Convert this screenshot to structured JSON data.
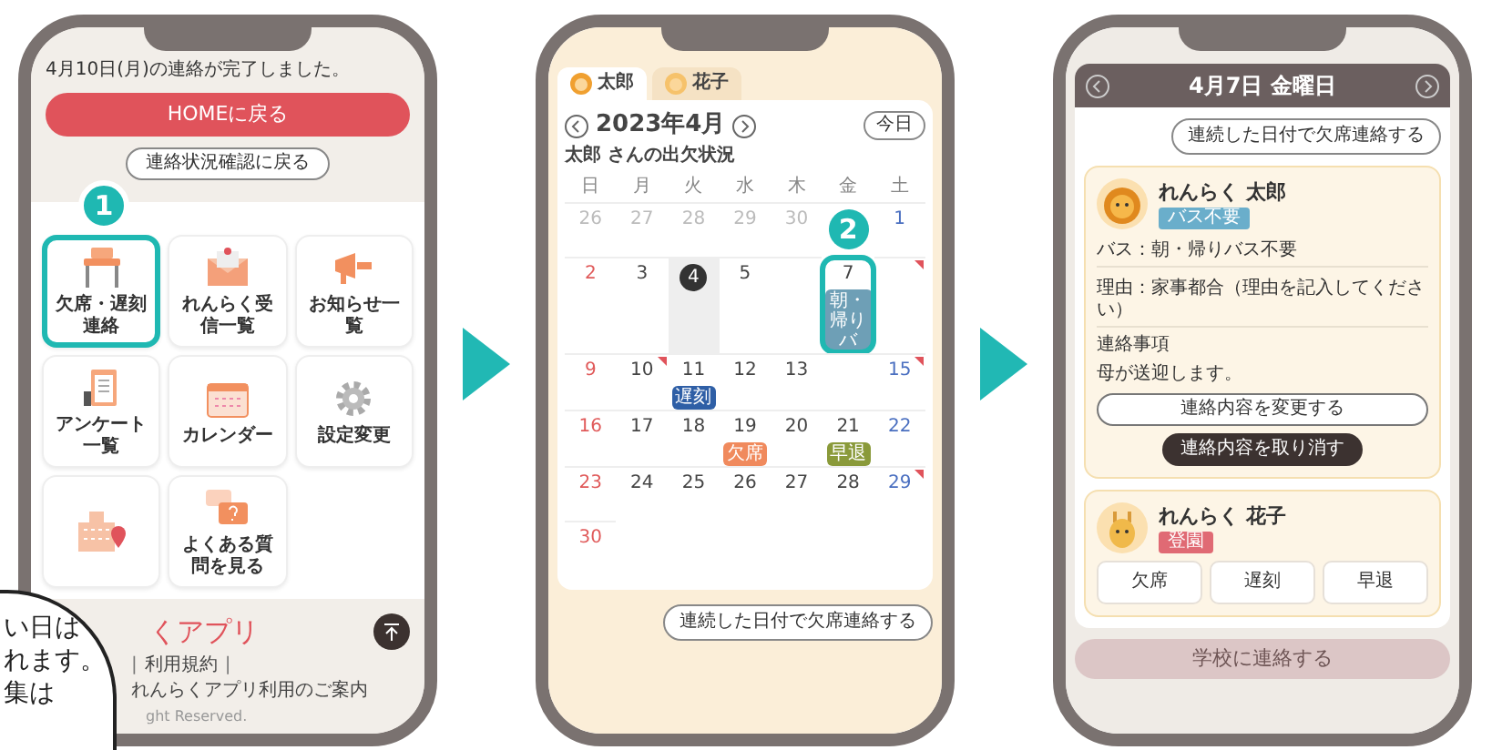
{
  "menu_screen": {
    "message": "4月10日(月)の連絡が完了しました。",
    "home_button": "HOMEに戻る",
    "status_button": "連絡状況確認に戻る",
    "step_badge": "1",
    "tiles": [
      {
        "label": "欠席・遅刻連絡",
        "highlighted": true
      },
      {
        "label": "れんらく受信一覧",
        "highlighted": false
      },
      {
        "label": "お知らせ一覧",
        "highlighted": false
      },
      {
        "label": "アンケート一覧",
        "highlighted": false
      },
      {
        "label": "カレンダー",
        "highlighted": false
      },
      {
        "label": "設定変更",
        "highlighted": false
      },
      {
        "highlighted": false
      },
      {
        "label": "よくある質問を見る",
        "highlighted": false
      }
    ],
    "app_name": "くアプリ",
    "separator": "|",
    "footer_links": [
      "利用規約",
      "れんらくアプリ利用のご案内"
    ],
    "copyright": "ght Reserved."
  },
  "callout_bubble": {
    "lines": [
      "い日は",
      "れます。",
      "集は"
    ]
  },
  "calendar_screen": {
    "tabs": [
      {
        "label": "太郎",
        "selected": true
      },
      {
        "label": "花子",
        "selected": false
      }
    ],
    "month": "2023年4月",
    "today_button": "今日",
    "subtitle": "太郎 さんの出欠状況",
    "weekdays": [
      "日",
      "月",
      "火",
      "水",
      "木",
      "金",
      "土"
    ],
    "weeks": [
      [
        {
          "day": "26",
          "outside": true,
          "today": false,
          "marked": false,
          "circled": false
        },
        {
          "day": "27",
          "outside": true,
          "today": false,
          "marked": false,
          "circled": false
        },
        {
          "day": "28",
          "outside": true,
          "today": false,
          "marked": false,
          "circled": false
        },
        {
          "day": "29",
          "outside": true,
          "today": false,
          "marked": false,
          "circled": false
        },
        {
          "day": "30",
          "outside": true,
          "today": false,
          "marked": false,
          "circled": false
        },
        {
          "step_badge": "2",
          "marked": false,
          "circled": false
        },
        {
          "day": "1",
          "outside": false,
          "today": false,
          "marked": false,
          "circled": false
        }
      ],
      [
        {
          "day": "2",
          "outside": false,
          "today": false,
          "marked": false,
          "circled": false
        },
        {
          "day": "3",
          "outside": false,
          "today": false,
          "marked": false,
          "circled": false
        },
        {
          "day": "4",
          "outside": false,
          "today": true,
          "marked": false,
          "circled": false
        },
        {
          "day": "5",
          "outside": false,
          "today": false,
          "marked": false,
          "circled": false
        },
        {
          "marked": false,
          "circled": false
        },
        {
          "day": "7",
          "outside": false,
          "today": false,
          "marked": false,
          "circled": true,
          "event": {
            "label": "朝・帰りバ",
            "color": "#6e9fb6"
          }
        },
        {
          "marked": true,
          "circled": false
        }
      ],
      [
        {
          "day": "9",
          "outside": false,
          "today": false,
          "marked": false,
          "circled": false
        },
        {
          "day": "10",
          "outside": false,
          "today": false,
          "marked": true,
          "circled": false
        },
        {
          "day": "11",
          "outside": false,
          "today": false,
          "marked": false,
          "circled": false,
          "event": {
            "label": "遅刻",
            "color": "#2f5fa6"
          }
        },
        {
          "day": "12",
          "outside": false,
          "today": false,
          "marked": false,
          "circled": false
        },
        {
          "day": "13",
          "outside": false,
          "today": false,
          "marked": false,
          "circled": false
        },
        {
          "marked": false,
          "circled": false
        },
        {
          "day": "15",
          "outside": false,
          "today": false,
          "marked": true,
          "circled": false
        }
      ],
      [
        {
          "day": "16",
          "outside": false,
          "today": false,
          "marked": false,
          "circled": false
        },
        {
          "day": "17",
          "outside": false,
          "today": false,
          "marked": false,
          "circled": false
        },
        {
          "day": "18",
          "outside": false,
          "today": false,
          "marked": false,
          "circled": false
        },
        {
          "day": "19",
          "outside": false,
          "today": false,
          "marked": false,
          "circled": false,
          "event": {
            "label": "欠席",
            "color": "#f08a5d"
          }
        },
        {
          "day": "20",
          "outside": false,
          "today": false,
          "marked": false,
          "circled": false
        },
        {
          "day": "21",
          "outside": false,
          "today": false,
          "marked": false,
          "circled": false,
          "event": {
            "label": "早退",
            "color": "#8a9a3a"
          }
        },
        {
          "day": "22",
          "outside": false,
          "today": false,
          "marked": false,
          "circled": false
        }
      ],
      [
        {
          "day": "23",
          "outside": false,
          "today": false,
          "marked": false,
          "circled": false
        },
        {
          "day": "24",
          "outside": false,
          "today": false,
          "marked": false,
          "circled": false
        },
        {
          "day": "25",
          "outside": false,
          "today": false,
          "marked": false,
          "circled": false
        },
        {
          "day": "26",
          "outside": false,
          "today": false,
          "marked": false,
          "circled": false
        },
        {
          "day": "27",
          "outside": false,
          "today": false,
          "marked": false,
          "circled": false
        },
        {
          "day": "28",
          "outside": false,
          "today": false,
          "marked": false,
          "circled": false
        },
        {
          "day": "29",
          "outside": false,
          "today": false,
          "marked": true,
          "circled": false
        }
      ],
      [
        {
          "day": "30",
          "outside": false,
          "today": false,
          "marked": false,
          "circled": false
        }
      ]
    ],
    "bulk_button": "連続した日付で欠席連絡する"
  },
  "detail_screen": {
    "date_title": "4月7日 金曜日",
    "bulk_button": "連続した日付で欠席連絡する",
    "students": [
      {
        "name": "れんらく 太郎",
        "tag": "バス不要",
        "color": "#6aaecb",
        "details": [
          "バス：朝・帰りバス不要",
          "理由：家事都合（理由を記入してください）"
        ],
        "note_title": "連絡事項",
        "note": "母が送迎します。",
        "actions": [
          {
            "label": "連絡内容を変更する",
            "kind": "outline"
          },
          {
            "label": "連絡内容を取り消す",
            "kind": "dark"
          }
        ]
      },
      {
        "name": "れんらく 花子",
        "tag": "登園",
        "color": "#e06a74",
        "actions": [
          {
            "label": "欠席",
            "kind": "choice"
          },
          {
            "label": "遅刻",
            "kind": "choice"
          },
          {
            "label": "早退",
            "kind": "choice"
          }
        ]
      }
    ],
    "submit_button": {
      "label": "学校に連絡する",
      "disabled": true
    }
  }
}
